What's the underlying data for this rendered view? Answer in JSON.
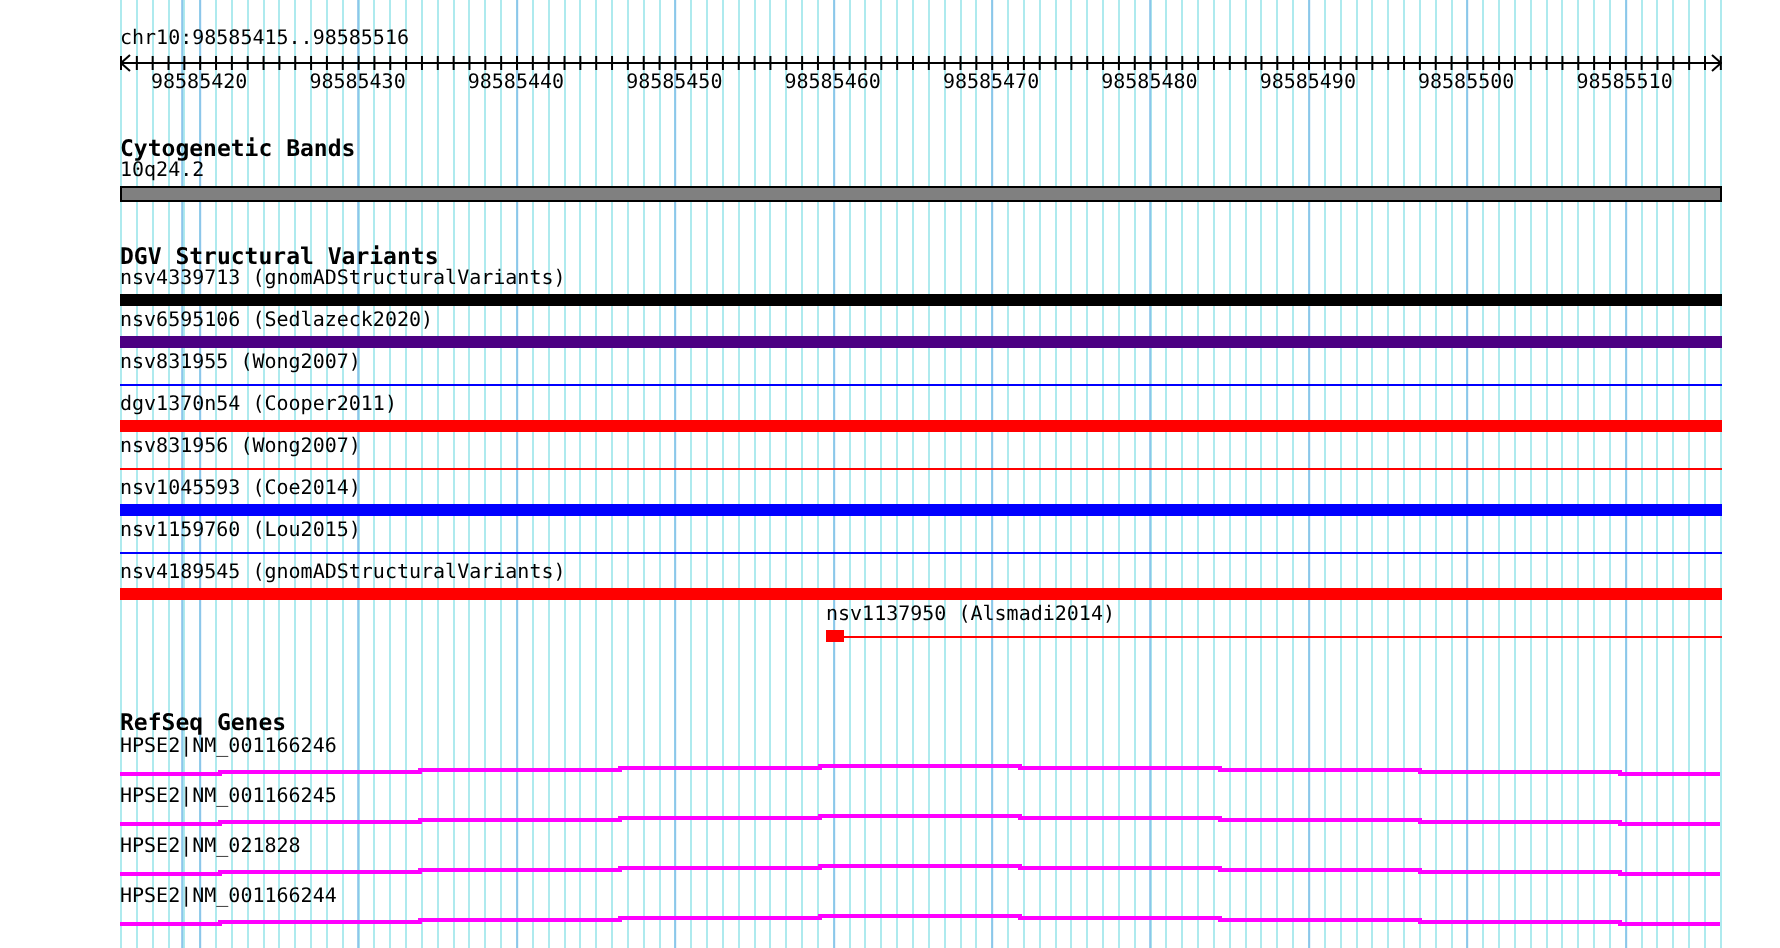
{
  "ruler": {
    "range": "chr10:98585415..98585516",
    "labels": [
      "98585420",
      "98585430",
      "98585440",
      "98585450",
      "98585460",
      "98585470",
      "98585480",
      "98585490",
      "98585500",
      "98585510"
    ]
  },
  "cytogenetic_bands": {
    "title": "Cytogenetic Bands",
    "features": [
      {
        "label": "10q24.2"
      }
    ]
  },
  "dgv_structural_variants": {
    "title": "DGV Structural Variants",
    "features": [
      {
        "label": "nsv4339713 (gnomADStructuralVariants)",
        "kind": "thick",
        "color": "#000000"
      },
      {
        "label": "nsv6595106 (Sedlazeck2020)",
        "kind": "thick",
        "color": "#4b0082"
      },
      {
        "label": "nsv831955 (Wong2007)",
        "kind": "thin",
        "color": "#0000ff"
      },
      {
        "label": "dgv1370n54 (Cooper2011)",
        "kind": "thick",
        "color": "#ff0000"
      },
      {
        "label": "nsv831956 (Wong2007)",
        "kind": "thin",
        "color": "#ff0000"
      },
      {
        "label": "nsv1045593 (Coe2014)",
        "kind": "thick",
        "color": "#0000ff"
      },
      {
        "label": "nsv1159760 (Lou2015)",
        "kind": "thin",
        "color": "#0000ff"
      },
      {
        "label": "nsv4189545 (gnomADStructuralVariants)",
        "kind": "thick",
        "color": "#ff0000"
      },
      {
        "label": "nsv1137950 (Alsmadi2014)",
        "kind": "short",
        "color": "#ff0000"
      }
    ]
  },
  "refseq_genes": {
    "title": "RefSeq Genes",
    "features": [
      {
        "label": "HPSE2|NM_001166246"
      },
      {
        "label": "HPSE2|NM_001166245"
      },
      {
        "label": "HPSE2|NM_021828"
      },
      {
        "label": "HPSE2|NM_001166244"
      }
    ]
  }
}
